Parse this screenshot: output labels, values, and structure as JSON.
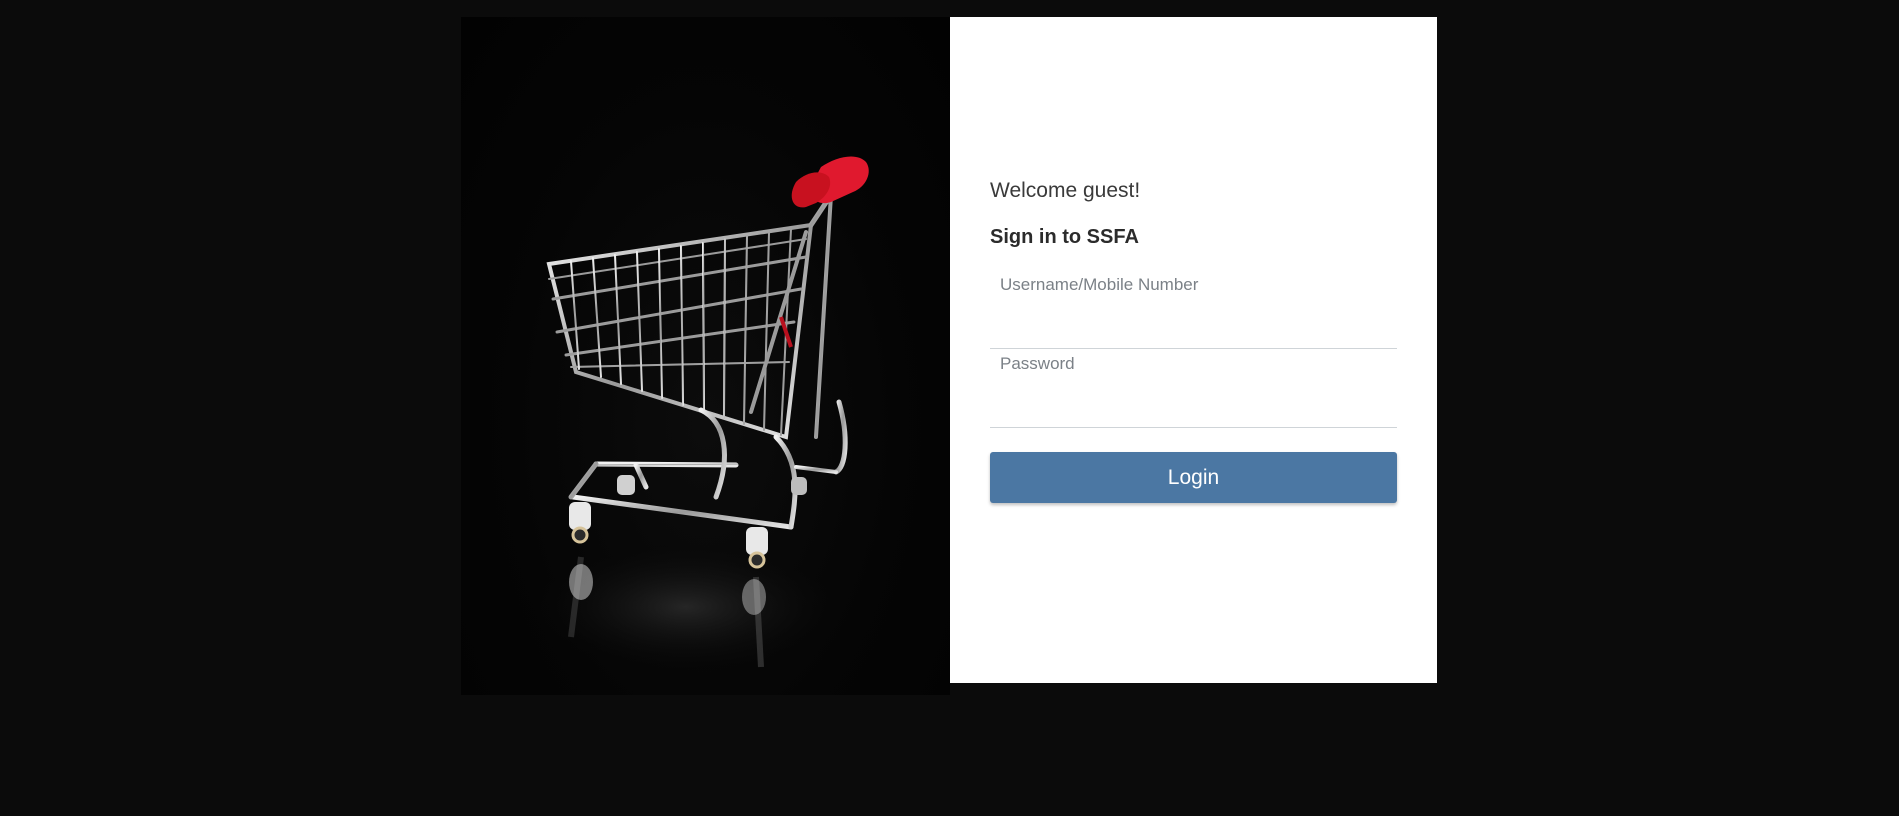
{
  "login_panel": {
    "welcome_text": "Welcome guest!",
    "heading": "Sign in to SSFA",
    "username_label": "Username/Mobile Number",
    "username_value": "",
    "password_label": "Password",
    "password_value": "",
    "login_label": "Login"
  },
  "colors": {
    "page_background": "#0b0b0b",
    "panel_background": "#ffffff",
    "login_button": "#4b77a3",
    "cart_handle": "#e0192e"
  },
  "hero_image": {
    "icon": "shopping-cart-icon"
  }
}
